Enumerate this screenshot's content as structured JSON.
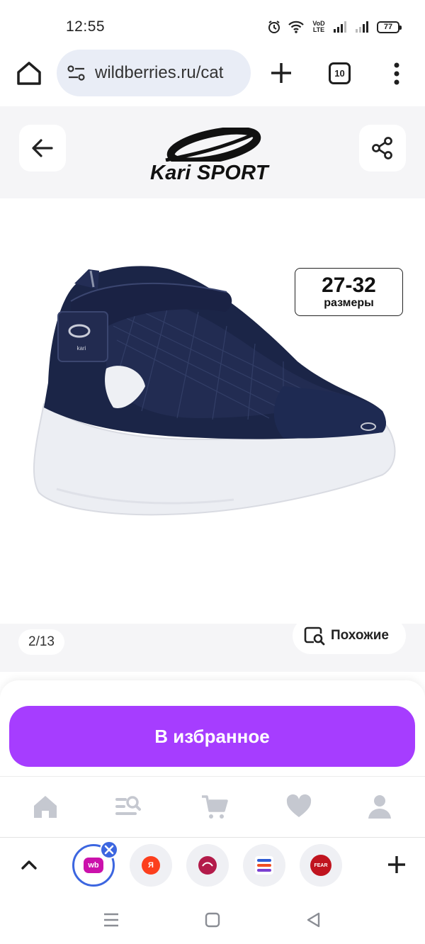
{
  "status_bar": {
    "time": "12:55",
    "network_label": "VoD LTE",
    "battery": "77"
  },
  "browser": {
    "url": "wildberries.ru/cat",
    "tab_count": "10"
  },
  "product": {
    "brand": "Kari SPORT",
    "sizes_range": "27-32",
    "sizes_label": "размеры",
    "photo_counter": "2/13",
    "similar_label": "Похожие"
  },
  "actions": {
    "favorite_label": "В избранное"
  },
  "quick_tabs": [
    {
      "name": "wb",
      "text": "wb",
      "color": "#cb11ab"
    },
    {
      "name": "yandex",
      "text": "Я",
      "color": "#fc3f1d"
    },
    {
      "name": "app-red",
      "text": "",
      "color": "#b31b4a"
    },
    {
      "name": "app-stack",
      "text": "",
      "color": "#2f5bd3"
    },
    {
      "name": "app-fear",
      "text": "FEAR",
      "color": "#c0141f"
    }
  ],
  "colors": {
    "accent": "#a63dff",
    "active_tab_ring": "#3c66e0",
    "nav_icon": "#c5c8d0"
  }
}
